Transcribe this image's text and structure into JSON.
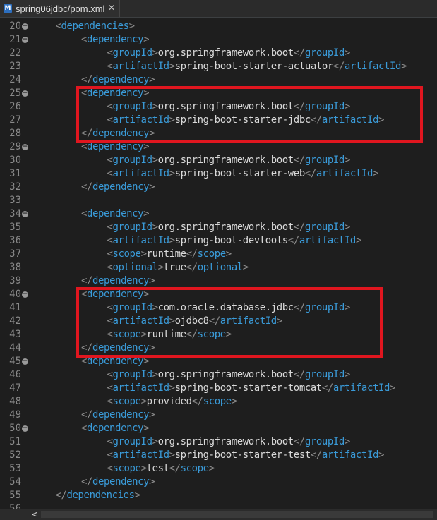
{
  "tab": {
    "icon": "M",
    "label": "spring06jdbc/pom.xml",
    "close": "✕"
  },
  "editor": {
    "lines": [
      {
        "num": "20",
        "fold": true,
        "indent": 1,
        "parts": [
          [
            "punct",
            "<"
          ],
          [
            "tag",
            "dependencies"
          ],
          [
            "punct",
            ">"
          ]
        ]
      },
      {
        "num": "21",
        "fold": true,
        "indent": 2,
        "parts": [
          [
            "punct",
            "<"
          ],
          [
            "tag",
            "dependency"
          ],
          [
            "punct",
            ">"
          ]
        ]
      },
      {
        "num": "22",
        "fold": false,
        "indent": 3,
        "parts": [
          [
            "punct",
            "<"
          ],
          [
            "tag",
            "groupId"
          ],
          [
            "punct",
            ">"
          ],
          [
            "text",
            "org.springframework.boot"
          ],
          [
            "punct",
            "</"
          ],
          [
            "tag",
            "groupId"
          ],
          [
            "punct",
            ">"
          ]
        ]
      },
      {
        "num": "23",
        "fold": false,
        "indent": 3,
        "parts": [
          [
            "punct",
            "<"
          ],
          [
            "tag",
            "artifactId"
          ],
          [
            "punct",
            ">"
          ],
          [
            "text",
            "spring-boot-starter-actuator"
          ],
          [
            "punct",
            "</"
          ],
          [
            "tag",
            "artifactId"
          ],
          [
            "punct",
            ">"
          ]
        ]
      },
      {
        "num": "24",
        "fold": false,
        "indent": 2,
        "parts": [
          [
            "punct",
            "</"
          ],
          [
            "tag",
            "dependency"
          ],
          [
            "punct",
            ">"
          ]
        ]
      },
      {
        "num": "25",
        "fold": true,
        "indent": 2,
        "parts": [
          [
            "punct",
            "<"
          ],
          [
            "tag",
            "dependency"
          ],
          [
            "punct",
            ">"
          ]
        ]
      },
      {
        "num": "26",
        "fold": false,
        "indent": 3,
        "parts": [
          [
            "punct",
            "<"
          ],
          [
            "tag",
            "groupId"
          ],
          [
            "punct",
            ">"
          ],
          [
            "text",
            "org.springframework.boot"
          ],
          [
            "punct",
            "</"
          ],
          [
            "tag",
            "groupId"
          ],
          [
            "punct",
            ">"
          ]
        ]
      },
      {
        "num": "27",
        "fold": false,
        "indent": 3,
        "parts": [
          [
            "punct",
            "<"
          ],
          [
            "tag",
            "artifactId"
          ],
          [
            "punct",
            ">"
          ],
          [
            "text",
            "spring-boot-starter-jdbc"
          ],
          [
            "punct",
            "</"
          ],
          [
            "tag",
            "artifactId"
          ],
          [
            "punct",
            ">"
          ]
        ]
      },
      {
        "num": "28",
        "fold": false,
        "indent": 2,
        "parts": [
          [
            "punct",
            "</"
          ],
          [
            "tag",
            "dependency"
          ],
          [
            "punct",
            ">"
          ]
        ]
      },
      {
        "num": "29",
        "fold": true,
        "indent": 2,
        "parts": [
          [
            "punct",
            "<"
          ],
          [
            "tag",
            "dependency"
          ],
          [
            "punct",
            ">"
          ]
        ]
      },
      {
        "num": "30",
        "fold": false,
        "indent": 3,
        "parts": [
          [
            "punct",
            "<"
          ],
          [
            "tag",
            "groupId"
          ],
          [
            "punct",
            ">"
          ],
          [
            "text",
            "org.springframework.boot"
          ],
          [
            "punct",
            "</"
          ],
          [
            "tag",
            "groupId"
          ],
          [
            "punct",
            ">"
          ]
        ]
      },
      {
        "num": "31",
        "fold": false,
        "indent": 3,
        "parts": [
          [
            "punct",
            "<"
          ],
          [
            "tag",
            "artifactId"
          ],
          [
            "punct",
            ">"
          ],
          [
            "text",
            "spring-boot-starter-web"
          ],
          [
            "punct",
            "</"
          ],
          [
            "tag",
            "artifactId"
          ],
          [
            "punct",
            ">"
          ]
        ]
      },
      {
        "num": "32",
        "fold": false,
        "indent": 2,
        "parts": [
          [
            "punct",
            "</"
          ],
          [
            "tag",
            "dependency"
          ],
          [
            "punct",
            ">"
          ]
        ]
      },
      {
        "num": "33",
        "fold": false,
        "indent": 0,
        "parts": []
      },
      {
        "num": "34",
        "fold": true,
        "indent": 2,
        "parts": [
          [
            "punct",
            "<"
          ],
          [
            "tag",
            "dependency"
          ],
          [
            "punct",
            ">"
          ]
        ]
      },
      {
        "num": "35",
        "fold": false,
        "indent": 3,
        "parts": [
          [
            "punct",
            "<"
          ],
          [
            "tag",
            "groupId"
          ],
          [
            "punct",
            ">"
          ],
          [
            "text",
            "org.springframework.boot"
          ],
          [
            "punct",
            "</"
          ],
          [
            "tag",
            "groupId"
          ],
          [
            "punct",
            ">"
          ]
        ]
      },
      {
        "num": "36",
        "fold": false,
        "indent": 3,
        "parts": [
          [
            "punct",
            "<"
          ],
          [
            "tag",
            "artifactId"
          ],
          [
            "punct",
            ">"
          ],
          [
            "text",
            "spring-boot-devtools"
          ],
          [
            "punct",
            "</"
          ],
          [
            "tag",
            "artifactId"
          ],
          [
            "punct",
            ">"
          ]
        ]
      },
      {
        "num": "37",
        "fold": false,
        "indent": 3,
        "parts": [
          [
            "punct",
            "<"
          ],
          [
            "tag",
            "scope"
          ],
          [
            "punct",
            ">"
          ],
          [
            "text",
            "runtime"
          ],
          [
            "punct",
            "</"
          ],
          [
            "tag",
            "scope"
          ],
          [
            "punct",
            ">"
          ]
        ]
      },
      {
        "num": "38",
        "fold": false,
        "indent": 3,
        "parts": [
          [
            "punct",
            "<"
          ],
          [
            "tag",
            "optional"
          ],
          [
            "punct",
            ">"
          ],
          [
            "text",
            "true"
          ],
          [
            "punct",
            "</"
          ],
          [
            "tag",
            "optional"
          ],
          [
            "punct",
            ">"
          ]
        ]
      },
      {
        "num": "39",
        "fold": false,
        "indent": 2,
        "parts": [
          [
            "punct",
            "</"
          ],
          [
            "tag",
            "dependency"
          ],
          [
            "punct",
            ">"
          ]
        ]
      },
      {
        "num": "40",
        "fold": true,
        "indent": 2,
        "parts": [
          [
            "punct",
            "<"
          ],
          [
            "tag",
            "dependency"
          ],
          [
            "punct",
            ">"
          ]
        ]
      },
      {
        "num": "41",
        "fold": false,
        "indent": 3,
        "parts": [
          [
            "punct",
            "<"
          ],
          [
            "tag",
            "groupId"
          ],
          [
            "punct",
            ">"
          ],
          [
            "text",
            "com.oracle.database.jdbc"
          ],
          [
            "punct",
            "</"
          ],
          [
            "tag",
            "groupId"
          ],
          [
            "punct",
            ">"
          ]
        ]
      },
      {
        "num": "42",
        "fold": false,
        "indent": 3,
        "parts": [
          [
            "punct",
            "<"
          ],
          [
            "tag",
            "artifactId"
          ],
          [
            "punct",
            ">"
          ],
          [
            "text",
            "ojdbc8"
          ],
          [
            "punct",
            "</"
          ],
          [
            "tag",
            "artifactId"
          ],
          [
            "punct",
            ">"
          ]
        ]
      },
      {
        "num": "43",
        "fold": false,
        "indent": 3,
        "parts": [
          [
            "punct",
            "<"
          ],
          [
            "tag",
            "scope"
          ],
          [
            "punct",
            ">"
          ],
          [
            "text",
            "runtime"
          ],
          [
            "punct",
            "</"
          ],
          [
            "tag",
            "scope"
          ],
          [
            "punct",
            ">"
          ]
        ]
      },
      {
        "num": "44",
        "fold": false,
        "indent": 2,
        "parts": [
          [
            "punct",
            "</"
          ],
          [
            "tag",
            "dependency"
          ],
          [
            "punct",
            ">"
          ]
        ]
      },
      {
        "num": "45",
        "fold": true,
        "indent": 2,
        "parts": [
          [
            "punct",
            "<"
          ],
          [
            "tag",
            "dependency"
          ],
          [
            "punct",
            ">"
          ]
        ]
      },
      {
        "num": "46",
        "fold": false,
        "indent": 3,
        "parts": [
          [
            "punct",
            "<"
          ],
          [
            "tag",
            "groupId"
          ],
          [
            "punct",
            ">"
          ],
          [
            "text",
            "org.springframework.boot"
          ],
          [
            "punct",
            "</"
          ],
          [
            "tag",
            "groupId"
          ],
          [
            "punct",
            ">"
          ]
        ]
      },
      {
        "num": "47",
        "fold": false,
        "indent": 3,
        "parts": [
          [
            "punct",
            "<"
          ],
          [
            "tag",
            "artifactId"
          ],
          [
            "punct",
            ">"
          ],
          [
            "text",
            "spring-boot-starter-tomcat"
          ],
          [
            "punct",
            "</"
          ],
          [
            "tag",
            "artifactId"
          ],
          [
            "punct",
            ">"
          ]
        ]
      },
      {
        "num": "48",
        "fold": false,
        "indent": 3,
        "parts": [
          [
            "punct",
            "<"
          ],
          [
            "tag",
            "scope"
          ],
          [
            "punct",
            ">"
          ],
          [
            "text",
            "provided"
          ],
          [
            "punct",
            "</"
          ],
          [
            "tag",
            "scope"
          ],
          [
            "punct",
            ">"
          ]
        ]
      },
      {
        "num": "49",
        "fold": false,
        "indent": 2,
        "parts": [
          [
            "punct",
            "</"
          ],
          [
            "tag",
            "dependency"
          ],
          [
            "punct",
            ">"
          ]
        ]
      },
      {
        "num": "50",
        "fold": true,
        "indent": 2,
        "parts": [
          [
            "punct",
            "<"
          ],
          [
            "tag",
            "dependency"
          ],
          [
            "punct",
            ">"
          ]
        ]
      },
      {
        "num": "51",
        "fold": false,
        "indent": 3,
        "parts": [
          [
            "punct",
            "<"
          ],
          [
            "tag",
            "groupId"
          ],
          [
            "punct",
            ">"
          ],
          [
            "text",
            "org.springframework.boot"
          ],
          [
            "punct",
            "</"
          ],
          [
            "tag",
            "groupId"
          ],
          [
            "punct",
            ">"
          ]
        ]
      },
      {
        "num": "52",
        "fold": false,
        "indent": 3,
        "parts": [
          [
            "punct",
            "<"
          ],
          [
            "tag",
            "artifactId"
          ],
          [
            "punct",
            ">"
          ],
          [
            "text",
            "spring-boot-starter-test"
          ],
          [
            "punct",
            "</"
          ],
          [
            "tag",
            "artifactId"
          ],
          [
            "punct",
            ">"
          ]
        ]
      },
      {
        "num": "53",
        "fold": false,
        "indent": 3,
        "parts": [
          [
            "punct",
            "<"
          ],
          [
            "tag",
            "scope"
          ],
          [
            "punct",
            ">"
          ],
          [
            "text",
            "test"
          ],
          [
            "punct",
            "</"
          ],
          [
            "tag",
            "scope"
          ],
          [
            "punct",
            ">"
          ]
        ]
      },
      {
        "num": "54",
        "fold": false,
        "indent": 2,
        "parts": [
          [
            "punct",
            "</"
          ],
          [
            "tag",
            "dependency"
          ],
          [
            "punct",
            ">"
          ]
        ]
      },
      {
        "num": "55",
        "fold": false,
        "indent": 1,
        "parts": [
          [
            "punct",
            "</"
          ],
          [
            "tag",
            "dependencies"
          ],
          [
            "punct",
            ">"
          ]
        ]
      },
      {
        "num": "56",
        "fold": false,
        "indent": 0,
        "parts": []
      }
    ]
  },
  "scrollbar": {
    "left_arrow": "<"
  },
  "colors": {
    "background": "#1e1e1e",
    "tag": "#3a9bd9",
    "text": "#d9d9d9",
    "punct": "#8c8c8c",
    "line_number": "#8a8a8a",
    "highlight": "#e0161f"
  }
}
